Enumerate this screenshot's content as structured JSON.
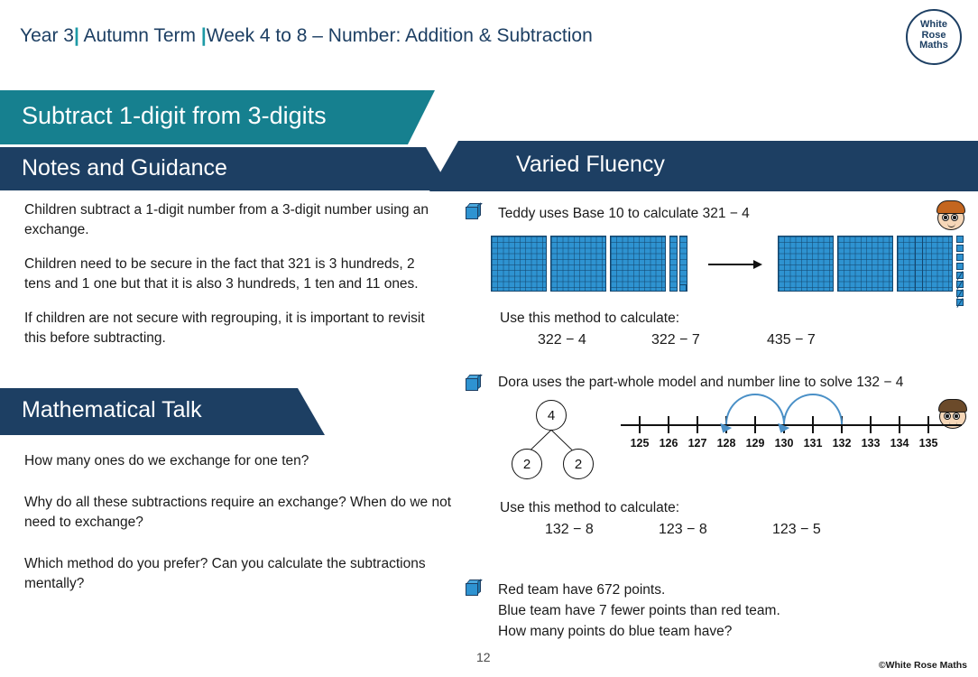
{
  "header": {
    "year": "Year 3",
    "sep1": "|",
    "term": "Autumn Term",
    "sep2": "|",
    "weeks": "Week 4 to 8 – Number: Addition & Subtraction",
    "logo": {
      "line1": "White",
      "line2": "Rose",
      "line3": "Maths"
    }
  },
  "title_banner": {
    "text": "Subtract 1-digit from 3-digits"
  },
  "notes": {
    "heading": "Notes and Guidance",
    "paragraphs": [
      "Children subtract a 1-digit number from a 3-digit number using an exchange.",
      "Children need to be secure in the fact that 321 is 3 hundreds, 2 tens and 1 one but that it is also 3 hundreds, 1 ten and 11 ones.",
      "If children are not secure with regrouping, it is important to revisit this before subtracting."
    ]
  },
  "talk": {
    "heading": "Mathematical Talk",
    "paragraphs": [
      "How many ones do we exchange for one ten?",
      "Why do all these subtractions require an exchange? When do we not need to exchange?",
      "Which method do you prefer? Can you calculate the subtractions mentally?"
    ]
  },
  "varied_fluency": {
    "heading": "Varied Fluency",
    "q1": {
      "prompt": "Teddy uses Base 10 to calculate 321 − 4",
      "use_method": "Use this method to calculate:",
      "calcs": [
        "322 − 4",
        "322 − 7",
        "435 − 7"
      ]
    },
    "q2": {
      "prompt": "Dora uses the part-whole model and number line to solve 132 − 4",
      "part_whole": {
        "whole": "4",
        "parts": [
          "2",
          "2"
        ]
      },
      "number_line": {
        "labels": [
          "125",
          "126",
          "127",
          "128",
          "129",
          "130",
          "131",
          "132",
          "133",
          "134",
          "135"
        ]
      },
      "use_method": "Use this method to calculate:",
      "calcs": [
        "132 − 8",
        "123 − 8",
        "123 − 5"
      ]
    },
    "q3": {
      "lines": [
        "Red team have 672 points.",
        "Blue team have 7 fewer points than red team.",
        "How many points do blue team have?"
      ]
    }
  },
  "footer": {
    "page_number": "12",
    "copyright": "©White Rose Maths"
  },
  "colors": {
    "navy": "#1d3f63",
    "teal": "#16808f",
    "blue": "#2e93d1"
  }
}
